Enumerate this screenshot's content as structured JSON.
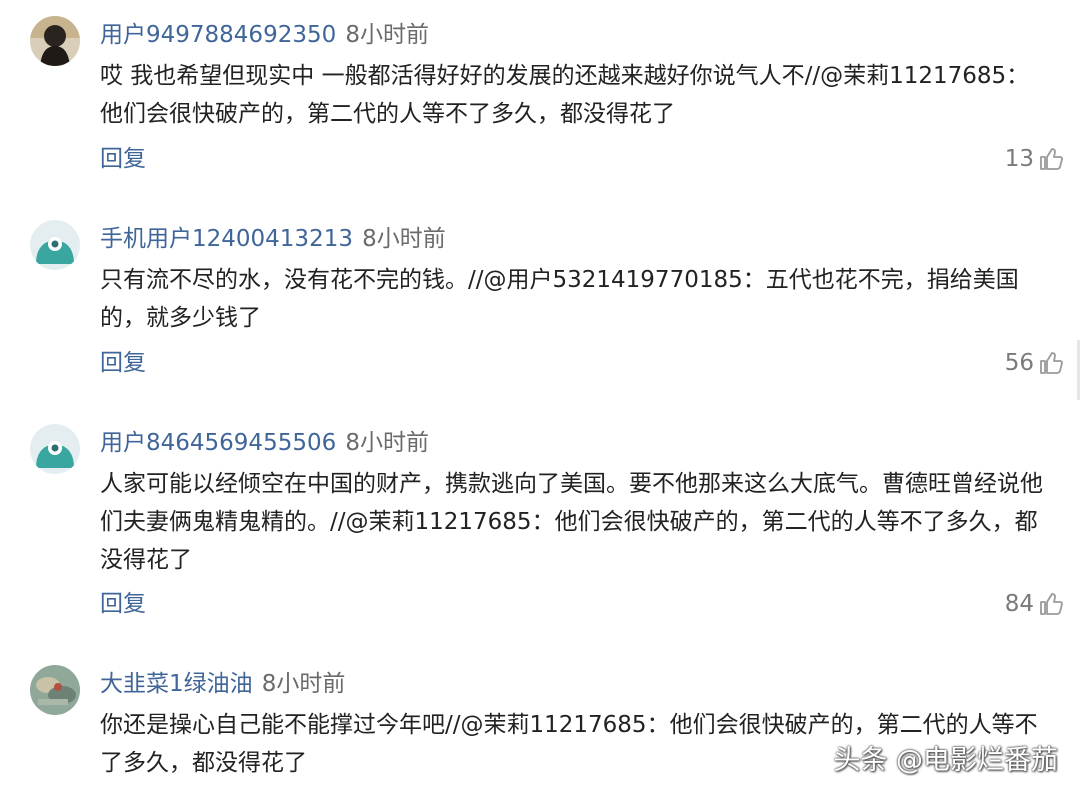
{
  "comments": [
    {
      "username": "用户9497884692350",
      "time": "8小时前",
      "text": "哎 我也希望但现实中 一般都活得好好的发展的还越来越好你说气人不//@茉莉11217685：\n他们会很快破产的，第二代的人等不了多久，都没得花了",
      "reply": "回复",
      "likes": "13",
      "avatar": "dark-figure-avatar"
    },
    {
      "username": "手机用户12400413213",
      "time": "8小时前",
      "text": "只有流不尽的水，没有花不完的钱。//@用户5321419770185：五代也花不完，捐给美国\n的，就多少钱了",
      "reply": "回复",
      "likes": "56",
      "avatar": "teal-default-avatar"
    },
    {
      "username": "用户8464569455506",
      "time": "8小时前",
      "text": "人家可能以经倾空在中国的财产，携款逃向了美国。要不他那来这么大底气。曹德旺曾经说他\n们夫妻俩鬼精鬼精的。//@茉莉11217685：他们会很快破产的，第二代的人等不了多久，都\n没得花了",
      "reply": "回复",
      "likes": "84",
      "avatar": "teal-default-avatar"
    },
    {
      "username": "大韭菜1绿油油",
      "time": "8小时前",
      "text": "你还是操心自己能不能撑过今年吧//@茉莉11217685：他们会很快破产的，第二代的人等不\n了多久，都没得花了",
      "avatar": "photo-avatar"
    }
  ],
  "watermark": "头条 @电影烂番茄",
  "colors": {
    "username": "#406599",
    "reply": "#406599",
    "time": "#6b6b6b",
    "likes": "#7a7a7a",
    "avatar_teal": "#3aa6a0"
  }
}
